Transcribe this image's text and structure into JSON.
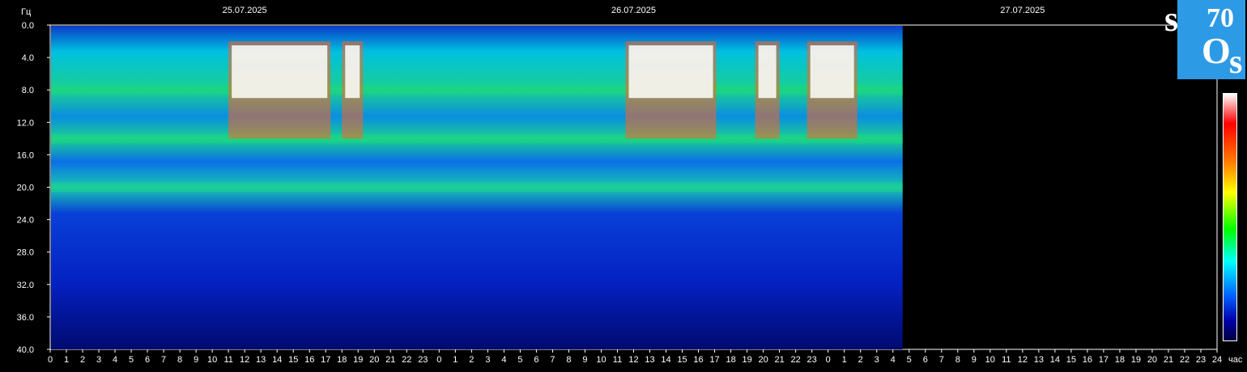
{
  "chart_data": {
    "type": "heatmap",
    "title": "",
    "ylabel": "Гц",
    "xlabel": "час",
    "y_ticks": [
      "0.0",
      "4.0",
      "8.0",
      "12.0",
      "16.0",
      "20.0",
      "24.0",
      "28.0",
      "32.0",
      "36.0",
      "40.0"
    ],
    "ylim": [
      0,
      40
    ],
    "dates": [
      "25.07.2025",
      "26.07.2025",
      "27.07.2025"
    ],
    "x_ticks": [
      "0",
      "1",
      "2",
      "3",
      "4",
      "5",
      "6",
      "7",
      "8",
      "9",
      "10",
      "11",
      "12",
      "13",
      "14",
      "15",
      "16",
      "17",
      "18",
      "19",
      "20",
      "21",
      "22",
      "23",
      "0",
      "1",
      "2",
      "3",
      "4",
      "5",
      "6",
      "7",
      "8",
      "9",
      "10",
      "11",
      "12",
      "13",
      "14",
      "15",
      "16",
      "17",
      "18",
      "19",
      "20",
      "21",
      "22",
      "23",
      "0",
      "1",
      "2",
      "3",
      "4",
      "5",
      "6",
      "7",
      "8",
      "9",
      "10",
      "11",
      "12",
      "13",
      "14",
      "15",
      "16",
      "17",
      "18",
      "19",
      "20",
      "21",
      "22",
      "23",
      "24"
    ],
    "data_end_hour": 52.6,
    "resonance_bands_hz": [
      8,
      14,
      20
    ],
    "bright_intervals_hours": [
      [
        11,
        17.3
      ],
      [
        18,
        19.3
      ],
      [
        35.5,
        41.1
      ],
      [
        43.5,
        45
      ],
      [
        46.7,
        49.8
      ]
    ],
    "colorscale": [
      "#000040",
      "#0000aa",
      "#0060ff",
      "#00ffff",
      "#00ff00",
      "#ffff00",
      "#ff8000",
      "#ff0000",
      "#ffffff"
    ]
  },
  "logo": {
    "top_left": "s",
    "top_right": "70",
    "bottom_left": "O",
    "bottom_right": "s"
  }
}
